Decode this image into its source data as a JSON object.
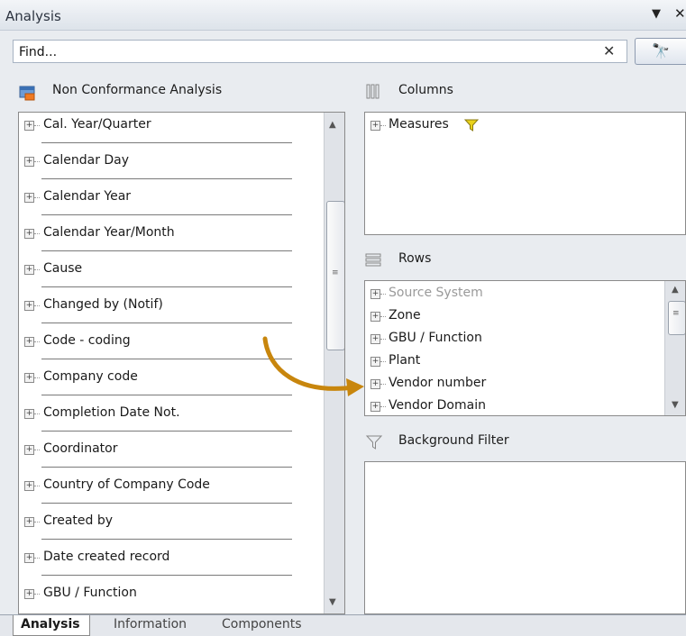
{
  "window": {
    "title": "Analysis",
    "pin_glyph": "▼",
    "close_glyph": "✕"
  },
  "find": {
    "placeholder": "Find...",
    "clear_glyph": "✕",
    "search_glyph": "🔭"
  },
  "left": {
    "header": "Non Conformance Analysis",
    "items": [
      "Cal. Year/Quarter",
      "Calendar Day",
      "Calendar Year",
      "Calendar Year/Month",
      "Cause",
      "Changed by (Notif)",
      "Code - coding",
      "Company code",
      "Completion Date Not.",
      "Coordinator",
      "Country of Company Code",
      "Created by",
      "Date created record",
      "GBU / Function"
    ]
  },
  "columns": {
    "header": "Columns",
    "items": [
      "Measures"
    ]
  },
  "rows": {
    "header": "Rows",
    "items": [
      "Source System",
      "Zone",
      "GBU / Function",
      "Plant",
      "Vendor number",
      "Vendor Domain"
    ]
  },
  "background_filter": {
    "header": "Background Filter"
  },
  "tabs": [
    "Analysis",
    "Information",
    "Components"
  ],
  "colors": {
    "accent_arrow": "#c8860d",
    "filter_yellow": "#e9d21c"
  }
}
